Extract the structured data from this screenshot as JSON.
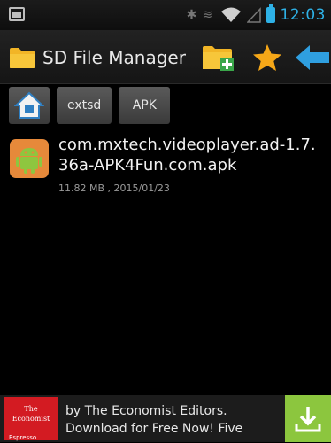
{
  "status_bar": {
    "time": "12:03",
    "icons": [
      "image-notification-icon",
      "bluetooth-icon",
      "vibrate-icon",
      "wifi-icon",
      "signal-icon",
      "battery-icon"
    ]
  },
  "action_bar": {
    "title": "SD File Manager",
    "actions": [
      "new-folder-icon",
      "star-icon",
      "back-arrow-icon"
    ]
  },
  "breadcrumbs": [
    {
      "label": "home-icon"
    },
    {
      "label": "extsd"
    },
    {
      "label": "APK"
    }
  ],
  "files": [
    {
      "name": "com.mxtech.videoplayer.ad-1.7.36a-APK4Fun.com.apk",
      "meta": "11.82 MB , 2015/01/23",
      "icon": "android-apk-icon"
    }
  ],
  "ad": {
    "logo_line1": "The",
    "logo_line2": "Economist",
    "logo_sub": "Espresso",
    "line1": "by The Economist Editors.",
    "line2": "Download for Free Now! Five",
    "brand_color": "#d31b22",
    "button_color": "#8cc63e"
  }
}
